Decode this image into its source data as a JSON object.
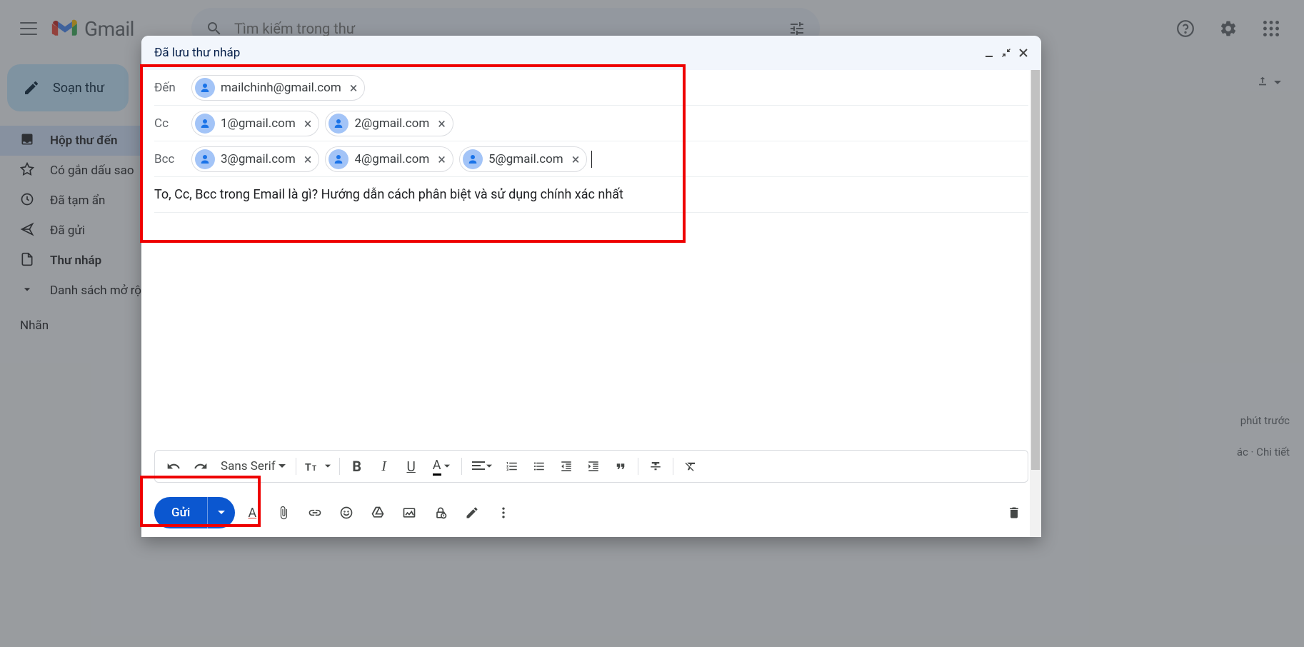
{
  "header": {
    "product_name": "Gmail",
    "search_placeholder": "Tìm kiếm trong thư"
  },
  "sidebar": {
    "compose_label": "Soạn thư",
    "items": [
      {
        "label": "Hộp thư đến",
        "selected": true,
        "bold": true,
        "icon": "inbox"
      },
      {
        "label": "Có gắn dấu sao",
        "selected": false,
        "bold": false,
        "icon": "star"
      },
      {
        "label": "Đã tạm ẩn",
        "selected": false,
        "bold": false,
        "icon": "clock"
      },
      {
        "label": "Đã gửi",
        "selected": false,
        "bold": false,
        "icon": "send"
      },
      {
        "label": "Thư nháp",
        "selected": false,
        "bold": true,
        "icon": "draft"
      },
      {
        "label": "Danh sách mở rộng",
        "selected": false,
        "bold": false,
        "icon": "expand"
      }
    ],
    "labels_header": "Nhãn"
  },
  "compose": {
    "title": "Đã lưu thư nháp",
    "to_label": "Đến",
    "cc_label": "Cc",
    "bcc_label": "Bcc",
    "to": [
      "mailchinh@gmail.com"
    ],
    "cc": [
      "1@gmail.com",
      "2@gmail.com"
    ],
    "bcc": [
      "3@gmail.com",
      "4@gmail.com",
      "5@gmail.com"
    ],
    "subject": "To, Cc, Bcc trong Email là gì? Hướng dẫn cách phân biệt và sử dụng chính xác nhất",
    "font_name": "Sans Serif",
    "send_label": "Gửi"
  },
  "side_info": {
    "line1": "phút trước",
    "line2": "ác · Chi tiết"
  }
}
